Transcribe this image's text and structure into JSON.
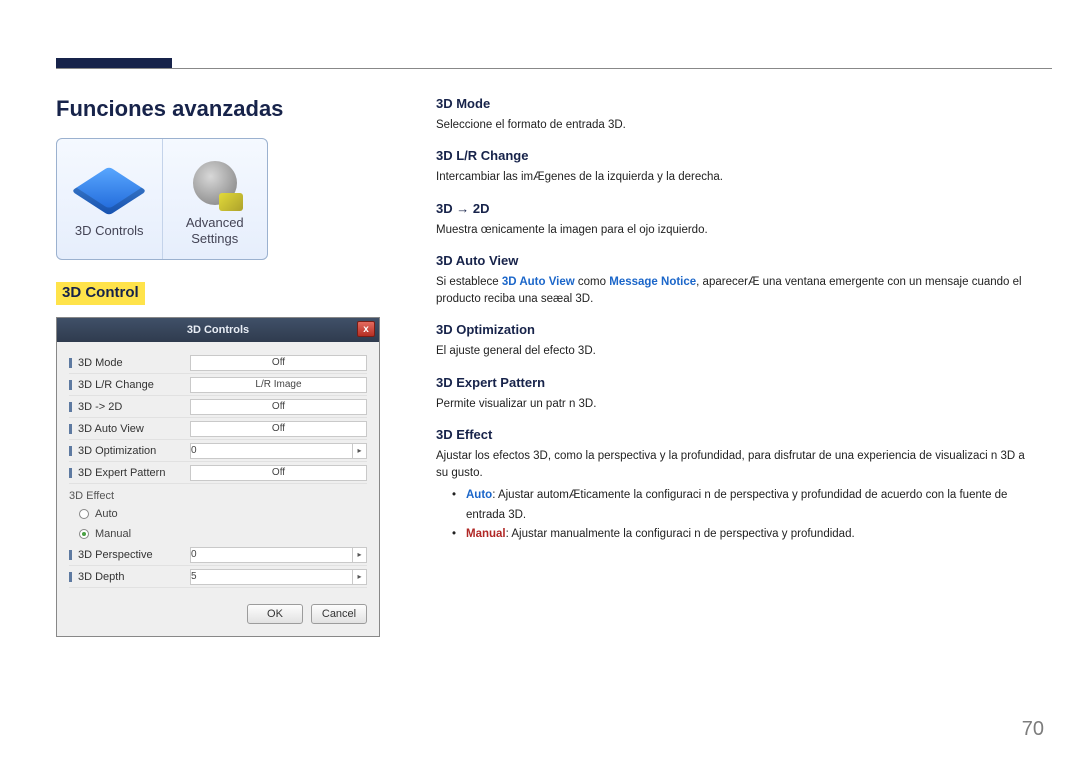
{
  "page": {
    "title": "Funciones avanzadas",
    "number": "70"
  },
  "tiles": {
    "controls": "3D Controls",
    "advanced_line1": "Advanced",
    "advanced_line2": "Settings"
  },
  "section": {
    "heading": "3D Control"
  },
  "dialog": {
    "title": "3D Controls",
    "close": "x",
    "rows": {
      "mode_label": "3D Mode",
      "mode_value": "Off",
      "lr_label": "3D L/R Change",
      "lr_value": "L/R Image",
      "to2d_label": "3D -> 2D",
      "to2d_value": "Off",
      "auto_label": "3D Auto View",
      "auto_value": "Off",
      "opt_label": "3D Optimization",
      "opt_value": "0",
      "pattern_label": "3D Expert Pattern",
      "pattern_value": "Off"
    },
    "effect_group": "3D Effect",
    "radio_auto": "Auto",
    "radio_manual": "Manual",
    "persp_label": "3D Perspective",
    "persp_value": "0",
    "depth_label": "3D Depth",
    "depth_value": "5",
    "ok": "OK",
    "cancel": "Cancel"
  },
  "right": {
    "mode_h": "3D Mode",
    "mode_t": "Seleccione el formato de entrada 3D.",
    "lr_h": "3D L/R Change",
    "lr_t": "Intercambiar las imÆgenes de la izquierda y la derecha.",
    "to2d_h": "3D → 2D",
    "to2d_t": "Muestra œnicamente la imagen para el ojo izquierdo.",
    "auto_h": "3D Auto View",
    "auto_t1": "Si establece ",
    "auto_kw1": "3D Auto View",
    "auto_t2": " como ",
    "auto_kw2": "Message Notice",
    "auto_t3": ", aparecerÆ una ventana emergente con un mensaje cuando el producto reciba una seæal 3D.",
    "opt_h": "3D Optimization",
    "opt_t": "El ajuste general del efecto 3D.",
    "pattern_h": "3D Expert Pattern",
    "pattern_t": "Permite visualizar un patr n 3D.",
    "effect_h": "3D Effect",
    "effect_t": "Ajustar los efectos 3D, como la perspectiva y la profundidad, para disfrutar de una experiencia de visualizaci n 3D a su gusto.",
    "effect_auto_kw": "Auto",
    "effect_auto_t": ": Ajustar automÆticamente la configuraci n de perspectiva y profundidad de acuerdo con la fuente de entrada 3D.",
    "effect_manual_kw": "Manual",
    "effect_manual_t": ": Ajustar manualmente la configuraci n de perspectiva y profundidad."
  }
}
